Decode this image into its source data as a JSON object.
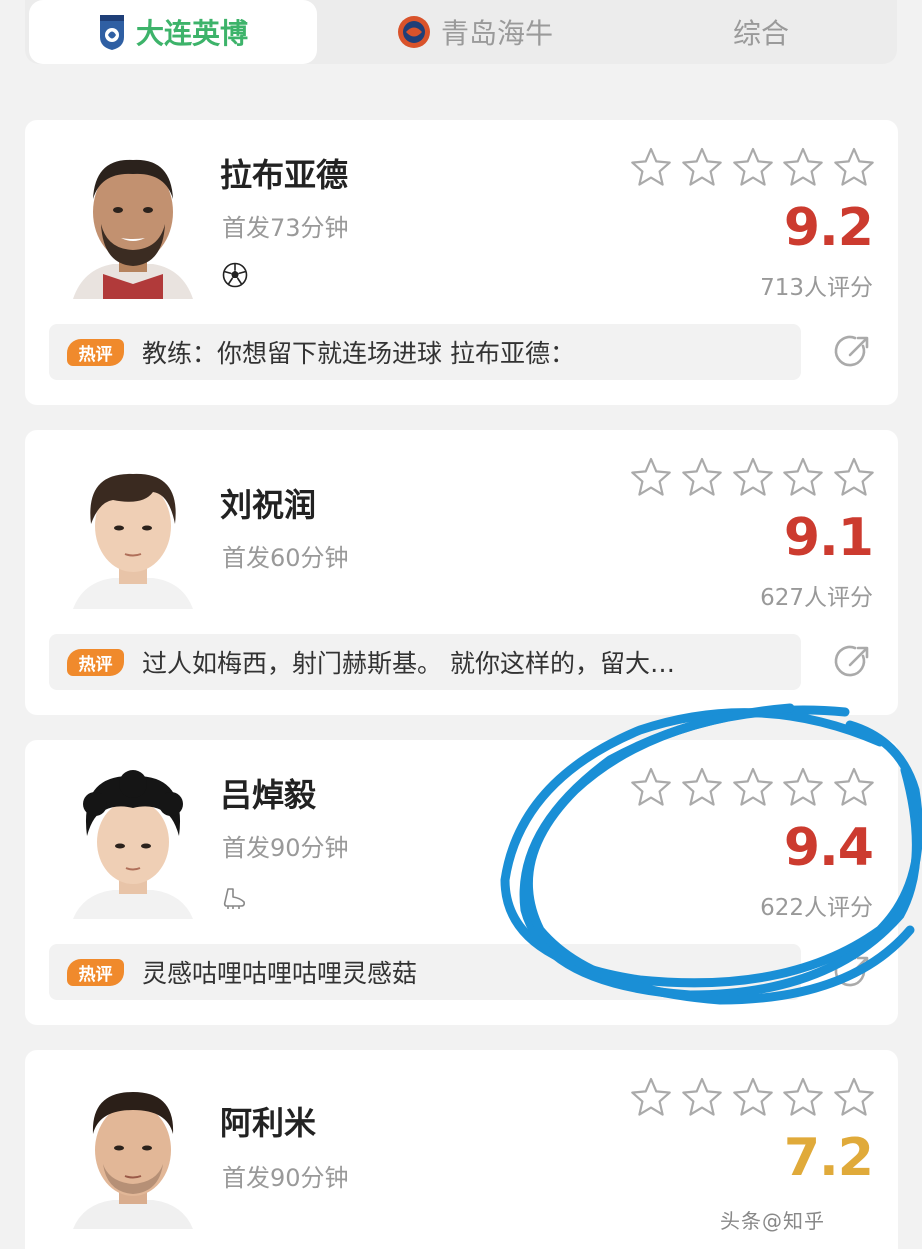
{
  "tabs": [
    {
      "label": "大连英博",
      "active": true,
      "logo": "dalian-yingbo-logo"
    },
    {
      "label": "青岛海牛",
      "active": false,
      "logo": "qingdao-hainiu-logo"
    },
    {
      "label": "综合",
      "active": false
    }
  ],
  "players": [
    {
      "name": "拉布亚德",
      "minutes": "首发73分钟",
      "event_icon": "soccer-ball-icon",
      "score": "9.2",
      "score_color": "#cc3b2f",
      "raters": "713人评分",
      "hot_tag": "热评",
      "comment": "教练：你想留下就连场进球 拉布亚德："
    },
    {
      "name": "刘祝润",
      "minutes": "首发60分钟",
      "event_icon": "",
      "score": "9.1",
      "score_color": "#cc3b2f",
      "raters": "627人评分",
      "hot_tag": "热评",
      "comment": "过人如梅西，射门赫斯基。 就你这样的，留大…"
    },
    {
      "name": "吕焯毅",
      "minutes": "首发90分钟",
      "event_icon": "boot-icon",
      "score": "9.4",
      "score_color": "#cc3b2f",
      "raters": "622人评分",
      "hot_tag": "热评",
      "comment": "灵感咕哩咕哩咕哩灵感菇"
    },
    {
      "name": "阿利米",
      "minutes": "首发90分钟",
      "event_icon": "",
      "score": "7.2",
      "score_color": "#e0aa3a",
      "raters": "",
      "hot_tag": "",
      "comment": ""
    }
  ],
  "stars_count": 5,
  "annotation_color": "#1a8fd6",
  "watermark": "头条@知乎"
}
